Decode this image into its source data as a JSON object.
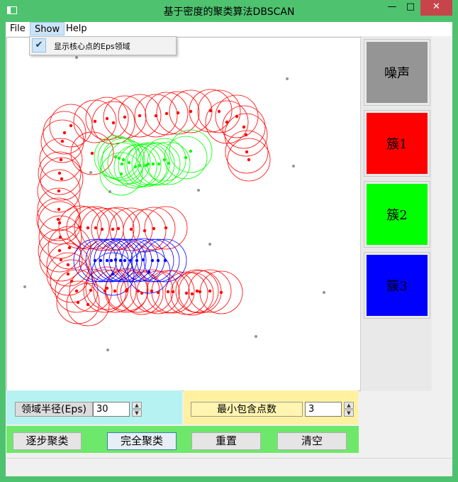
{
  "window": {
    "title": "基于密度的聚类算法DBSCAN",
    "minimize_glyph": "—",
    "maximize_glyph": "□",
    "close_glyph": "✕"
  },
  "menu": {
    "items": [
      "File",
      "Show",
      "Help"
    ],
    "open_menu": "Show",
    "dropdown": {
      "checked": true,
      "check_glyph": "✔",
      "label": "显示核心点的Eps领域"
    }
  },
  "legend": [
    {
      "label": "噪声",
      "color": "#959595"
    },
    {
      "label": "簇1",
      "color": "#ff0000"
    },
    {
      "label": "簇2",
      "color": "#00ff00"
    },
    {
      "label": "簇3",
      "color": "#0000ff"
    }
  ],
  "params": {
    "eps_label": "领域半径(Eps)",
    "eps_value": "30",
    "minpts_label": "最小包含点数",
    "minpts_value": "3"
  },
  "buttons": {
    "step": "逐步聚类",
    "full": "完全聚类",
    "reset": "重置",
    "clear": "清空"
  },
  "colors": {
    "frame": "#4fc26f",
    "noise": "#959595",
    "cluster1": "#ff0000",
    "cluster2": "#00ff00",
    "cluster3": "#0000ff"
  },
  "scatter": {
    "eps": 30,
    "noise": [
      [
        98,
        28
      ],
      [
        395,
        58
      ],
      [
        118,
        190
      ],
      [
        145,
        217
      ],
      [
        270,
        215
      ],
      [
        404,
        181
      ],
      [
        286,
        291
      ],
      [
        25,
        351
      ],
      [
        447,
        359
      ],
      [
        351,
        421
      ],
      [
        142,
        440
      ]
    ],
    "cluster1": [
      [
        81,
        134
      ],
      [
        124,
        118
      ],
      [
        141,
        114
      ],
      [
        166,
        112
      ],
      [
        187,
        110
      ],
      [
        210,
        110
      ],
      [
        225,
        107
      ],
      [
        241,
        106
      ],
      [
        259,
        104
      ],
      [
        287,
        103
      ],
      [
        299,
        104
      ],
      [
        324,
        111
      ],
      [
        310,
        119
      ],
      [
        334,
        126
      ],
      [
        337,
        137
      ],
      [
        338,
        161
      ],
      [
        341,
        172
      ],
      [
        78,
        146
      ],
      [
        90,
        124
      ],
      [
        76,
        172
      ],
      [
        74,
        191
      ],
      [
        73,
        216
      ],
      [
        73,
        242
      ],
      [
        74,
        261
      ],
      [
        75,
        281
      ],
      [
        74,
        300
      ],
      [
        86,
        320
      ],
      [
        86,
        333
      ],
      [
        72,
        256
      ],
      [
        103,
        267
      ],
      [
        114,
        268
      ],
      [
        125,
        268
      ],
      [
        134,
        270
      ],
      [
        149,
        270
      ],
      [
        157,
        269
      ],
      [
        175,
        270
      ],
      [
        194,
        272
      ],
      [
        224,
        268
      ],
      [
        207,
        269
      ],
      [
        88,
        296
      ],
      [
        76,
        313
      ],
      [
        91,
        343
      ],
      [
        98,
        357
      ],
      [
        118,
        356
      ],
      [
        114,
        376
      ],
      [
        100,
        373
      ],
      [
        138,
        357
      ],
      [
        152,
        357
      ],
      [
        141,
        353
      ],
      [
        168,
        357
      ],
      [
        185,
        357
      ],
      [
        204,
        357
      ],
      [
        213,
        359
      ],
      [
        227,
        358
      ],
      [
        234,
        358
      ],
      [
        253,
        360
      ],
      [
        261,
        361
      ],
      [
        268,
        357
      ],
      [
        286,
        357
      ],
      [
        302,
        359
      ],
      [
        169,
        355
      ],
      [
        190,
        360
      ],
      [
        77,
        199
      ],
      [
        120,
        163
      ],
      [
        150,
        120
      ],
      [
        272,
        358
      ]
    ],
    "cluster2": [
      [
        153,
        168
      ],
      [
        158,
        170
      ],
      [
        164,
        172
      ],
      [
        162,
        178
      ],
      [
        172,
        176
      ],
      [
        187,
        180
      ],
      [
        199,
        178
      ],
      [
        206,
        178
      ],
      [
        214,
        178
      ],
      [
        222,
        172
      ],
      [
        228,
        177
      ],
      [
        252,
        169
      ],
      [
        259,
        160
      ],
      [
        161,
        192
      ],
      [
        196,
        180
      ],
      [
        181,
        182
      ]
    ],
    "cluster3": [
      [
        124,
        314
      ],
      [
        132,
        314
      ],
      [
        141,
        314
      ],
      [
        147,
        314
      ],
      [
        153,
        313
      ],
      [
        160,
        314
      ],
      [
        166,
        314
      ],
      [
        174,
        314
      ],
      [
        183,
        314
      ],
      [
        192,
        313
      ],
      [
        205,
        314
      ],
      [
        213,
        314
      ],
      [
        223,
        314
      ],
      [
        200,
        330
      ],
      [
        149,
        333
      ]
    ]
  }
}
